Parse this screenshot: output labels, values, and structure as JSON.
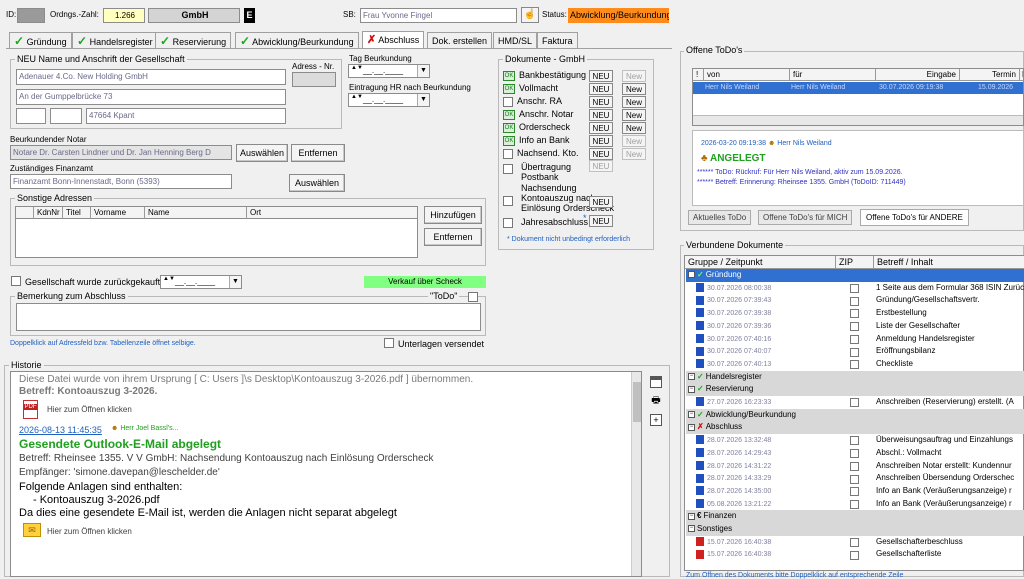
{
  "header": {
    "id_label": "ID:",
    "ordngs_label": "Ordngs.-Zahl:",
    "ordngs_value": "1.266",
    "company_type": "GmbH",
    "e_badge": "E",
    "sb_label": "SB:",
    "sb_value": "Frau Yvonne Fingel",
    "status_label": "Status:",
    "status_value": "Abwicklung/Beurkundung",
    "status_color": "#ff8c1a"
  },
  "tabs": [
    {
      "label": "Gründung",
      "mark": "check"
    },
    {
      "label": "Handelsregister",
      "mark": "check"
    },
    {
      "label": "Reservierung",
      "mark": "check"
    },
    {
      "label": "Abwicklung/Beurkundung",
      "mark": "check"
    },
    {
      "label": "Abschluss",
      "mark": "x"
    },
    {
      "label": "Dok. erstellen",
      "mark": ""
    },
    {
      "label": "HMD/SL",
      "mark": ""
    },
    {
      "label": "Faktura",
      "mark": ""
    }
  ],
  "company": {
    "group_title": "NEU Name und Anschrift der Gesellschaft",
    "adress_nr_label": "Adress - Nr.",
    "line1": "Adenauer 4.Co. New Holding GmbH",
    "line2": "An der Gumppelbrücke 73",
    "zip": "47664 Kpant"
  },
  "dates": {
    "tag_label": "Tag Beurkundung",
    "tag_value": "__.__.____",
    "hr_label": "Eintragung HR nach Beurkundung",
    "hr_value": "__.__.____"
  },
  "notar": {
    "label": "Beurkundender Notar",
    "value": "Notare Dr. Carsten Lindner und Dr. Jan Henning Berg D",
    "select_button": "Auswählen",
    "remove_button": "Entfernen"
  },
  "finanzamt": {
    "label": "Zuständiges Finanzamt",
    "value": "Finanzamt Bonn-Innenstadt, Bonn (5393)",
    "select_button": "Auswählen"
  },
  "sonstige": {
    "group_title": "Sonstige Adressen",
    "columns": [
      "KdnNr",
      "Titel",
      "Vorname",
      "Name",
      "Ort"
    ],
    "add_button": "Hinzufügen",
    "remove_button": "Entfernen"
  },
  "bottom_left": {
    "zurueck_label": "Gesellschaft wurde zurückgekauft:",
    "zurueck_date": "__.__.____",
    "verkauf_badge": "Verkauf über Scheck",
    "bemerkung_label": "Bemerkung zum Abschluss",
    "todo_label": "\"ToDo\"",
    "hint": "Doppelklick auf Adressfeld bzw. Tabellenzeile öffnet selbige.",
    "unterlagen_label": "Unterlagen versendet"
  },
  "dokumente": {
    "group_title": "Dokumente - GmbH",
    "items": [
      {
        "label": "Bankbestätigung",
        "checked": true,
        "neu": "NEU",
        "new": "New",
        "new_disabled": true
      },
      {
        "label": "Vollmacht",
        "checked": true,
        "neu": "NEU",
        "new": "New",
        "new_disabled": false
      },
      {
        "label": "Anschr. RA",
        "checked": false,
        "neu": "NEU",
        "new": "New",
        "new_disabled": false
      },
      {
        "label": "Anschr. Notar",
        "checked": true,
        "neu": "NEU",
        "new": "New",
        "new_disabled": false
      },
      {
        "label": "Orderscheck",
        "checked": true,
        "neu": "NEU",
        "new": "New",
        "new_disabled": false
      },
      {
        "label": "Info an Bank",
        "checked": true,
        "neu": "NEU",
        "new": "New",
        "new_disabled": true
      },
      {
        "label": "Nachsend. Kto.",
        "checked": false,
        "neu": "NEU",
        "new": "New",
        "new_disabled": true
      }
    ],
    "uebertragung_label": "Übertragung Postbank",
    "uebertragung_btn": "NEU",
    "nachsendung_label": "Nachsendung Kontoauszug nach Einlösung Orderscheck",
    "nachsendung_btn": "NEU",
    "jahres_label": "Jahresabschluss",
    "jahres_btn": "NEU",
    "footnote": "* Dokument nicht unbedingt erforderlich"
  },
  "todos": {
    "group_title": "Offene ToDo's",
    "columns": [
      "!",
      "von",
      "für",
      "Eingabe",
      "Termin",
      "E"
    ],
    "row": {
      "von": "Herr Nils Weiland",
      "fuer": "Herr Nils Weiland",
      "eingabe": "30.07.2026 09:19:38",
      "termin": "15.09.2026"
    },
    "note_date": "2026-03-20 09:19:38",
    "note_author": "Herr Nils Weiland",
    "note_title": "ANGELEGT",
    "note_line1": "****** ToDo: Rückruf: Für Herr Nils Weiland, aktiv zum 15.09.2026.",
    "note_line2": "****** Betreff: Erinnerung: Rheinsee 1355. GmbH (ToDoID: 711449)",
    "tabs": [
      "Aktuelles ToDo",
      "Offene ToDo's für MICH",
      "Offene ToDo's für ANDERE"
    ]
  },
  "documents": {
    "group_title": "Verbundene Dokumente",
    "columns": [
      "Gruppe / Zeitpunkt",
      "ZIP",
      "Betreff / Inhalt"
    ],
    "rows": [
      {
        "type": "group",
        "mark": "check",
        "label": "Gründung",
        "selected": true
      },
      {
        "type": "doc",
        "icon": "doc",
        "time": "30.07.2026 08:00:38",
        "text": "1 Seite aus dem Formular 368 ISIN Zurück"
      },
      {
        "type": "doc",
        "icon": "doc",
        "time": "30.07.2026 07:39:43",
        "text": "Gründung/Gesellschaftsvertr."
      },
      {
        "type": "doc",
        "icon": "doc",
        "time": "30.07.2026 07:39:38",
        "text": "Erstbestellung"
      },
      {
        "type": "doc",
        "icon": "doc",
        "time": "30.07.2026 07:39:36",
        "text": "Liste der Gesellschafter"
      },
      {
        "type": "doc",
        "icon": "doc",
        "time": "30.07.2026 07:40:16",
        "text": "Anmeldung Handelsregister"
      },
      {
        "type": "doc",
        "icon": "doc",
        "time": "30.07.2026 07:40:07",
        "text": "Eröffnungsbilanz"
      },
      {
        "type": "doc",
        "icon": "doc",
        "time": "30.07.2026 07:40:13",
        "text": "Checkliste"
      },
      {
        "type": "group",
        "mark": "check",
        "label": "Handelsregister",
        "selected": false
      },
      {
        "type": "group",
        "mark": "check",
        "label": "Reservierung",
        "selected": false
      },
      {
        "type": "doc",
        "icon": "doc",
        "time": "27.07.2026 16:23:33",
        "text": "Anschreiben (Reservierung) erstellt. (A"
      },
      {
        "type": "group",
        "mark": "check",
        "label": "Abwicklung/Beurkundung",
        "selected": false
      },
      {
        "type": "group",
        "mark": "x",
        "label": "Abschluss",
        "selected": false
      },
      {
        "type": "doc",
        "icon": "doc",
        "time": "28.07.2026 13:32:48",
        "text": "Überweisungsauftrag und Einzahlungs"
      },
      {
        "type": "doc",
        "icon": "doc",
        "time": "28.07.2026 14:29:43",
        "text": "Abschl.: Vollmacht"
      },
      {
        "type": "doc",
        "icon": "doc",
        "time": "28.07.2026 14:31:22",
        "text": "Anschreiben Notar erstellt: Kundennur"
      },
      {
        "type": "doc",
        "icon": "doc",
        "time": "28.07.2026 14:33:29",
        "text": "Anschreiben Übersendung Orderschec"
      },
      {
        "type": "doc",
        "icon": "doc",
        "time": "28.07.2026 14:35:00",
        "text": "Info an Bank (Veräußerungsanzeige) r"
      },
      {
        "type": "doc",
        "icon": "doc",
        "time": "05.08.2026 13:21:22",
        "text": "Info an Bank (Veräußerungsanzeige) r"
      },
      {
        "type": "group",
        "mark": "euro",
        "label": "Finanzen",
        "selected": false
      },
      {
        "type": "group",
        "mark": "",
        "label": "Sonstiges",
        "selected": false
      },
      {
        "type": "doc",
        "icon": "pdf",
        "time": "15.07.2026 16:40:38",
        "text": "Gesellschafterbeschluss"
      },
      {
        "type": "doc",
        "icon": "pdf",
        "time": "15.07.2026 16:40:38",
        "text": "Gesellschafterliste"
      }
    ],
    "footer": "Zum Öffnen des Dokuments bitte Doppelklick auf entsprechende Zeile"
  },
  "historie": {
    "group_title": "Historie",
    "top_line": "Diese Datei wurde von ihrem Ursprung [ C: Users ]\\s Desktop\\Kontoauszug 3-2026.pdf ] übernommen.",
    "top_betreff": "Betreff: Kontoauszug 3-2026.",
    "pdf_link": "Hier zum Öffnen klicken",
    "entry_date": "2026-08-13 11:45:35",
    "entry_author": "Herr Joel Bassl's...",
    "entry_title": "Gesendete Outlook-E-Mail abgelegt",
    "betreff": "Betreff: Rheinsee 1355. V V GmbH: Nachsendung Kontoauszug nach Einlösung Orderscheck",
    "empfaenger": "Empfänger: 'simone.davepan@leschelder.de'",
    "anlagen": "Folgende Anlagen sind enthalten:",
    "anlage1": "- Kontoauszug 3-2026.pdf",
    "hinweis": "Da dies eine gesendete E-Mail ist, werden die Anlagen nicht separat abgelegt",
    "mail_link": "Hier zum Öffnen klicken"
  }
}
